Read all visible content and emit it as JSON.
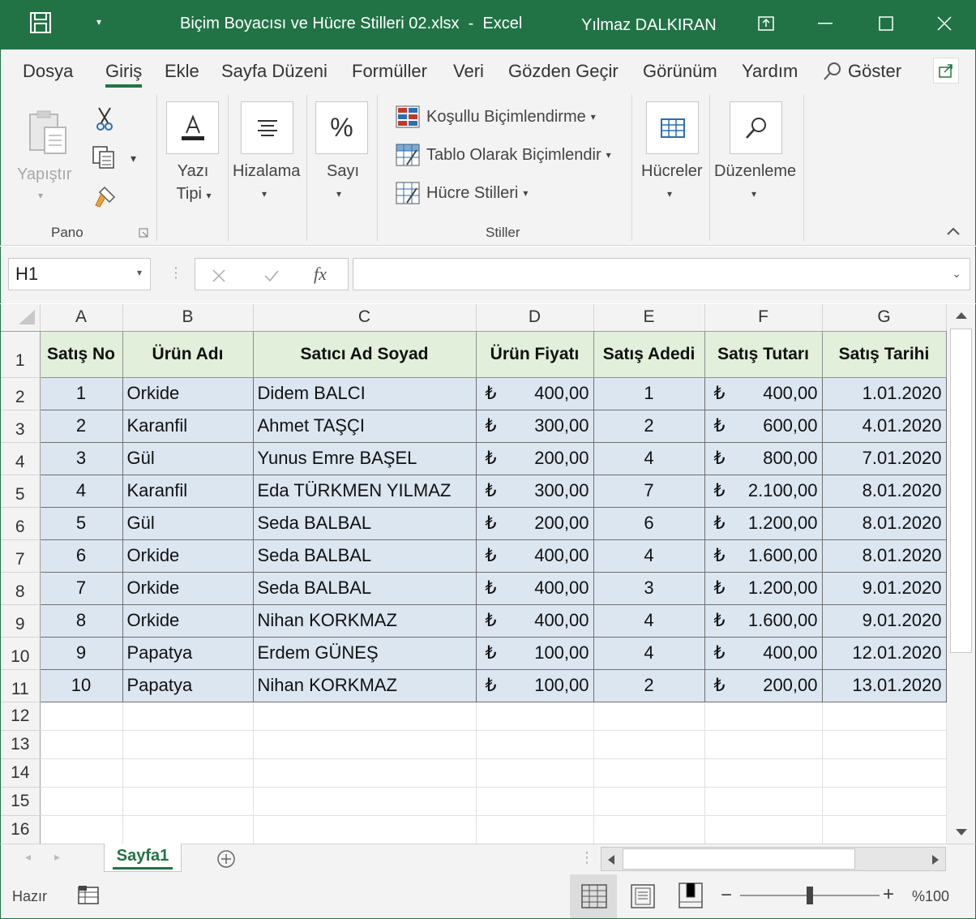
{
  "window": {
    "title": "Biçim Boyacısı ve Hücre Stilleri 02.xlsx  -  Excel",
    "user": "Yılmaz DALKIRAN",
    "accent_color": "#217346"
  },
  "ribbon_tabs": [
    "Dosya",
    "Giriş",
    "Ekle",
    "Sayfa Düzeni",
    "Formüller",
    "Veri",
    "Gözden Geçir",
    "Görünüm",
    "Yardım"
  ],
  "active_tab": "Giriş",
  "tell_me": "Göster",
  "ribbon": {
    "pano": {
      "paste_label": "Yapıştır",
      "group_label": "Pano"
    },
    "font_label_1": "Yazı",
    "font_label_2": "Tipi",
    "align_label": "Hizalama",
    "number_label": "Sayı",
    "number_icon": "%",
    "styles": {
      "conditional": "Koşullu Biçimlendirme",
      "as_table": "Tablo Olarak Biçimlendir",
      "cell_styles": "Hücre Stilleri",
      "group_label": "Stiller"
    },
    "cells_label": "Hücreler",
    "editing_label": "Düzenleme"
  },
  "formula_bar": {
    "name_box": "H1",
    "fx": "fx",
    "formula": ""
  },
  "columns": [
    "A",
    "B",
    "C",
    "D",
    "E",
    "F",
    "G"
  ],
  "header_row": [
    "Satış No",
    "Ürün Adı",
    "Satıcı Ad Soyad",
    "Ürün Fiyatı",
    "Satış Adedi",
    "Satış Tutarı",
    "Satış Tarihi"
  ],
  "currency_symbol": "₺",
  "rows": [
    [
      "1",
      "Orkide",
      "Didem BALCI",
      "400,00",
      "1",
      "400,00",
      "1.01.2020"
    ],
    [
      "2",
      "Karanfil",
      "Ahmet TAŞÇI",
      "300,00",
      "2",
      "600,00",
      "4.01.2020"
    ],
    [
      "3",
      "Gül",
      "Yunus Emre BAŞEL",
      "200,00",
      "4",
      "800,00",
      "7.01.2020"
    ],
    [
      "4",
      "Karanfil",
      "Eda TÜRKMEN YILMAZ",
      "300,00",
      "7",
      "2.100,00",
      "8.01.2020"
    ],
    [
      "5",
      "Gül",
      "Seda BALBAL",
      "200,00",
      "6",
      "1.200,00",
      "8.01.2020"
    ],
    [
      "6",
      "Orkide",
      "Seda BALBAL",
      "400,00",
      "4",
      "1.600,00",
      "8.01.2020"
    ],
    [
      "7",
      "Orkide",
      "Seda BALBAL",
      "400,00",
      "3",
      "1.200,00",
      "9.01.2020"
    ],
    [
      "8",
      "Orkide",
      "Nihan KORKMAZ",
      "400,00",
      "4",
      "1.600,00",
      "9.01.2020"
    ],
    [
      "9",
      "Papatya",
      "Erdem GÜNEŞ",
      "100,00",
      "4",
      "400,00",
      "12.01.2020"
    ],
    [
      "10",
      "Papatya",
      "Nihan KORKMAZ",
      "100,00",
      "2",
      "200,00",
      "13.01.2020"
    ]
  ],
  "row_numbers": [
    "1",
    "2",
    "3",
    "4",
    "5",
    "6",
    "7",
    "8",
    "9",
    "10",
    "11",
    "12",
    "13",
    "14",
    "15",
    "16"
  ],
  "sheet_tab": "Sayfa1",
  "status": {
    "ready": "Hazır",
    "zoom": "%100",
    "zoom_minus": "−",
    "zoom_plus": "+",
    "zoom_level_percent": 100
  }
}
